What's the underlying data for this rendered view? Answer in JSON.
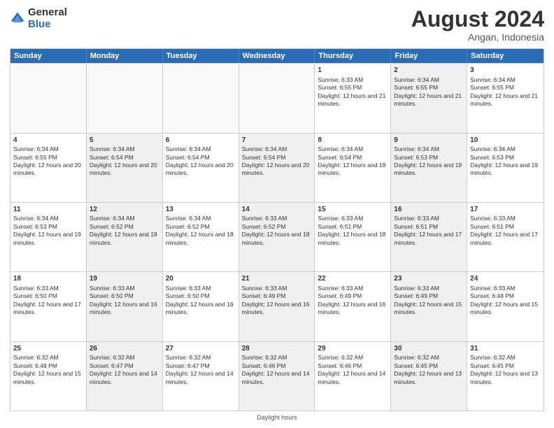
{
  "logo": {
    "general": "General",
    "blue": "Blue"
  },
  "title": "August 2024",
  "subtitle": "Angan, Indonesia",
  "header_days": [
    "Sunday",
    "Monday",
    "Tuesday",
    "Wednesday",
    "Thursday",
    "Friday",
    "Saturday"
  ],
  "footer": "Daylight hours",
  "weeks": [
    [
      {
        "day": "",
        "sunrise": "",
        "sunset": "",
        "daylight": "",
        "shaded": false,
        "empty": true
      },
      {
        "day": "",
        "sunrise": "",
        "sunset": "",
        "daylight": "",
        "shaded": false,
        "empty": true
      },
      {
        "day": "",
        "sunrise": "",
        "sunset": "",
        "daylight": "",
        "shaded": false,
        "empty": true
      },
      {
        "day": "",
        "sunrise": "",
        "sunset": "",
        "daylight": "",
        "shaded": false,
        "empty": true
      },
      {
        "day": "1",
        "sunrise": "Sunrise: 6:33 AM",
        "sunset": "Sunset: 6:55 PM",
        "daylight": "Daylight: 12 hours and 21 minutes.",
        "shaded": false,
        "empty": false
      },
      {
        "day": "2",
        "sunrise": "Sunrise: 6:34 AM",
        "sunset": "Sunset: 6:55 PM",
        "daylight": "Daylight: 12 hours and 21 minutes.",
        "shaded": true,
        "empty": false
      },
      {
        "day": "3",
        "sunrise": "Sunrise: 6:34 AM",
        "sunset": "Sunset: 6:55 PM",
        "daylight": "Daylight: 12 hours and 21 minutes.",
        "shaded": false,
        "empty": false
      }
    ],
    [
      {
        "day": "4",
        "sunrise": "Sunrise: 6:34 AM",
        "sunset": "Sunset: 6:55 PM",
        "daylight": "Daylight: 12 hours and 20 minutes.",
        "shaded": false,
        "empty": false
      },
      {
        "day": "5",
        "sunrise": "Sunrise: 6:34 AM",
        "sunset": "Sunset: 6:54 PM",
        "daylight": "Daylight: 12 hours and 20 minutes.",
        "shaded": true,
        "empty": false
      },
      {
        "day": "6",
        "sunrise": "Sunrise: 6:34 AM",
        "sunset": "Sunset: 6:54 PM",
        "daylight": "Daylight: 12 hours and 20 minutes.",
        "shaded": false,
        "empty": false
      },
      {
        "day": "7",
        "sunrise": "Sunrise: 6:34 AM",
        "sunset": "Sunset: 6:54 PM",
        "daylight": "Daylight: 12 hours and 20 minutes.",
        "shaded": true,
        "empty": false
      },
      {
        "day": "8",
        "sunrise": "Sunrise: 6:34 AM",
        "sunset": "Sunset: 6:54 PM",
        "daylight": "Daylight: 12 hours and 19 minutes.",
        "shaded": false,
        "empty": false
      },
      {
        "day": "9",
        "sunrise": "Sunrise: 6:34 AM",
        "sunset": "Sunset: 6:53 PM",
        "daylight": "Daylight: 12 hours and 19 minutes.",
        "shaded": true,
        "empty": false
      },
      {
        "day": "10",
        "sunrise": "Sunrise: 6:34 AM",
        "sunset": "Sunset: 6:53 PM",
        "daylight": "Daylight: 12 hours and 19 minutes.",
        "shaded": false,
        "empty": false
      }
    ],
    [
      {
        "day": "11",
        "sunrise": "Sunrise: 6:34 AM",
        "sunset": "Sunset: 6:53 PM",
        "daylight": "Daylight: 12 hours and 19 minutes.",
        "shaded": false,
        "empty": false
      },
      {
        "day": "12",
        "sunrise": "Sunrise: 6:34 AM",
        "sunset": "Sunset: 6:52 PM",
        "daylight": "Daylight: 12 hours and 18 minutes.",
        "shaded": true,
        "empty": false
      },
      {
        "day": "13",
        "sunrise": "Sunrise: 6:34 AM",
        "sunset": "Sunset: 6:52 PM",
        "daylight": "Daylight: 12 hours and 18 minutes.",
        "shaded": false,
        "empty": false
      },
      {
        "day": "14",
        "sunrise": "Sunrise: 6:33 AM",
        "sunset": "Sunset: 6:52 PM",
        "daylight": "Daylight: 12 hours and 18 minutes.",
        "shaded": true,
        "empty": false
      },
      {
        "day": "15",
        "sunrise": "Sunrise: 6:33 AM",
        "sunset": "Sunset: 6:51 PM",
        "daylight": "Daylight: 12 hours and 18 minutes.",
        "shaded": false,
        "empty": false
      },
      {
        "day": "16",
        "sunrise": "Sunrise: 6:33 AM",
        "sunset": "Sunset: 6:51 PM",
        "daylight": "Daylight: 12 hours and 17 minutes.",
        "shaded": true,
        "empty": false
      },
      {
        "day": "17",
        "sunrise": "Sunrise: 6:33 AM",
        "sunset": "Sunset: 6:51 PM",
        "daylight": "Daylight: 12 hours and 17 minutes.",
        "shaded": false,
        "empty": false
      }
    ],
    [
      {
        "day": "18",
        "sunrise": "Sunrise: 6:33 AM",
        "sunset": "Sunset: 6:50 PM",
        "daylight": "Daylight: 12 hours and 17 minutes.",
        "shaded": false,
        "empty": false
      },
      {
        "day": "19",
        "sunrise": "Sunrise: 6:33 AM",
        "sunset": "Sunset: 6:50 PM",
        "daylight": "Daylight: 12 hours and 16 minutes.",
        "shaded": true,
        "empty": false
      },
      {
        "day": "20",
        "sunrise": "Sunrise: 6:33 AM",
        "sunset": "Sunset: 6:50 PM",
        "daylight": "Daylight: 12 hours and 16 minutes.",
        "shaded": false,
        "empty": false
      },
      {
        "day": "21",
        "sunrise": "Sunrise: 6:33 AM",
        "sunset": "Sunset: 6:49 PM",
        "daylight": "Daylight: 12 hours and 16 minutes.",
        "shaded": true,
        "empty": false
      },
      {
        "day": "22",
        "sunrise": "Sunrise: 6:33 AM",
        "sunset": "Sunset: 6:49 PM",
        "daylight": "Daylight: 12 hours and 16 minutes.",
        "shaded": false,
        "empty": false
      },
      {
        "day": "23",
        "sunrise": "Sunrise: 6:33 AM",
        "sunset": "Sunset: 6:49 PM",
        "daylight": "Daylight: 12 hours and 15 minutes.",
        "shaded": true,
        "empty": false
      },
      {
        "day": "24",
        "sunrise": "Sunrise: 6:33 AM",
        "sunset": "Sunset: 6:48 PM",
        "daylight": "Daylight: 12 hours and 15 minutes.",
        "shaded": false,
        "empty": false
      }
    ],
    [
      {
        "day": "25",
        "sunrise": "Sunrise: 6:32 AM",
        "sunset": "Sunset: 6:48 PM",
        "daylight": "Daylight: 12 hours and 15 minutes.",
        "shaded": false,
        "empty": false
      },
      {
        "day": "26",
        "sunrise": "Sunrise: 6:32 AM",
        "sunset": "Sunset: 6:47 PM",
        "daylight": "Daylight: 12 hours and 14 minutes.",
        "shaded": true,
        "empty": false
      },
      {
        "day": "27",
        "sunrise": "Sunrise: 6:32 AM",
        "sunset": "Sunset: 6:47 PM",
        "daylight": "Daylight: 12 hours and 14 minutes.",
        "shaded": false,
        "empty": false
      },
      {
        "day": "28",
        "sunrise": "Sunrise: 6:32 AM",
        "sunset": "Sunset: 6:46 PM",
        "daylight": "Daylight: 12 hours and 14 minutes.",
        "shaded": true,
        "empty": false
      },
      {
        "day": "29",
        "sunrise": "Sunrise: 6:32 AM",
        "sunset": "Sunset: 6:46 PM",
        "daylight": "Daylight: 12 hours and 14 minutes.",
        "shaded": false,
        "empty": false
      },
      {
        "day": "30",
        "sunrise": "Sunrise: 6:32 AM",
        "sunset": "Sunset: 6:45 PM",
        "daylight": "Daylight: 12 hours and 13 minutes.",
        "shaded": true,
        "empty": false
      },
      {
        "day": "31",
        "sunrise": "Sunrise: 6:32 AM",
        "sunset": "Sunset: 6:45 PM",
        "daylight": "Daylight: 12 hours and 13 minutes.",
        "shaded": false,
        "empty": false
      }
    ]
  ]
}
